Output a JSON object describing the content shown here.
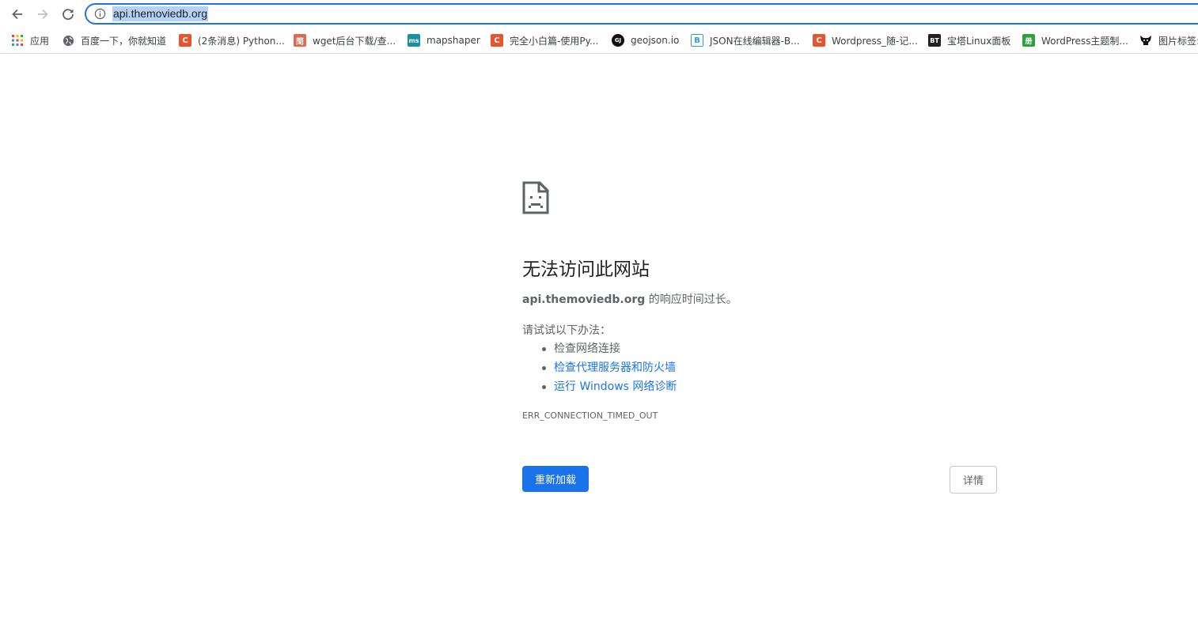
{
  "browser": {
    "address_bar": {
      "url": "api.themoviedb.org"
    },
    "bookmarks": [
      {
        "label": "应用",
        "icon": "apps-grid-icon"
      },
      {
        "label": "百度一下，你就知道",
        "icon": "globe-icon"
      },
      {
        "label": "(2条消息) Python...",
        "icon": "csdn-icon",
        "icon_text": "C"
      },
      {
        "label": "wget后台下载/查...",
        "icon": "jianshu-icon",
        "icon_text": "简"
      },
      {
        "label": "mapshaper",
        "icon": "mapshaper-icon",
        "icon_text": "ms"
      },
      {
        "label": "完全小白篇-使用Py...",
        "icon": "csdn-icon",
        "icon_text": "C"
      },
      {
        "label": "geojson.io",
        "icon": "geojson-icon",
        "icon_text": "GJ"
      },
      {
        "label": "JSON在线编辑器-B...",
        "icon": "bejson-icon",
        "icon_text": "B"
      },
      {
        "label": "Wordpress_随-记...",
        "icon": "csdn-icon",
        "icon_text": "C"
      },
      {
        "label": "宝塔Linux面板",
        "icon": "bt-panel-icon",
        "icon_text": "BT"
      },
      {
        "label": "WordPress主题制...",
        "icon": "green-site-icon",
        "icon_text": "册"
      },
      {
        "label": "图片标签:",
        "icon": "wolf-icon"
      }
    ]
  },
  "error_page": {
    "title": "无法访问此网站",
    "host": "api.themoviedb.org",
    "desc_suffix": " 的响应时间过长。",
    "try_label": "请试试以下办法：",
    "suggestions": [
      {
        "text": "检查网络连接",
        "link": false
      },
      {
        "text": "检查代理服务器和防火墙",
        "link": true
      },
      {
        "text": "运行 Windows 网络诊断",
        "link": true
      }
    ],
    "error_code": "ERR_CONNECTION_TIMED_OUT",
    "reload_label": "重新加载",
    "details_label": "详情"
  },
  "colors": {
    "accent": "#1a73e8",
    "text_secondary": "#5f6368",
    "csdn": "#e8542e",
    "jianshu": "#e0694f",
    "mapshaper": "#1b8ea8",
    "bt": "#202124",
    "green": "#2e9f3a"
  }
}
